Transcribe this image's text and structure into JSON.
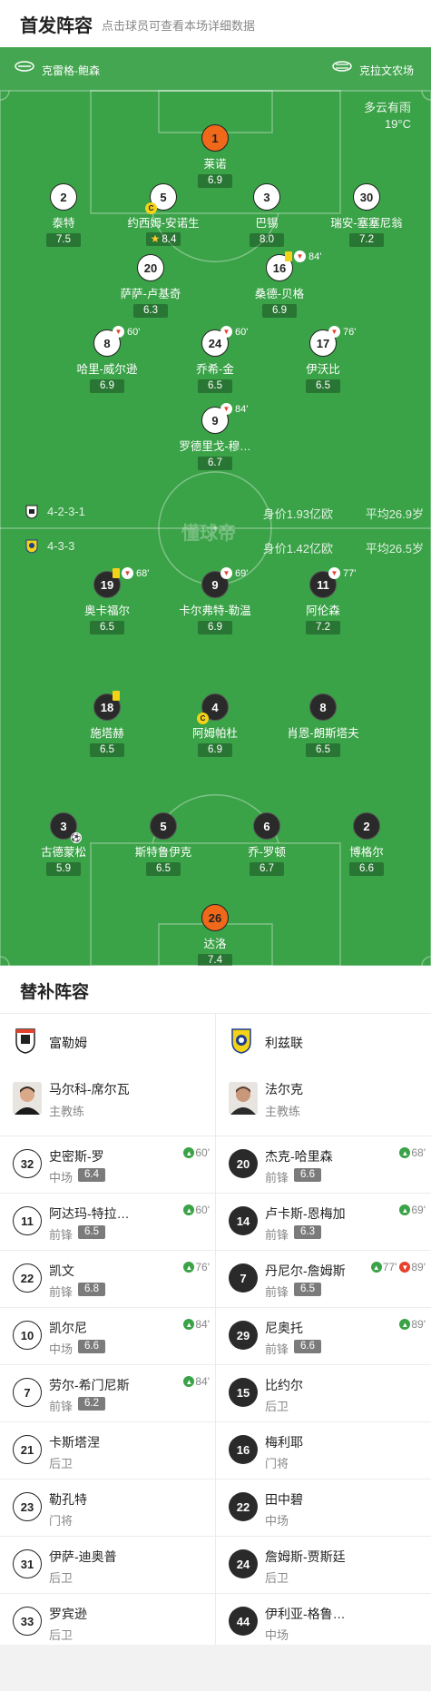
{
  "header": {
    "title": "首发阵容",
    "hint": "点击球员可查看本场详细数据"
  },
  "teams": {
    "home_label": "克雷格-鲍森",
    "away_label": "克拉文农场"
  },
  "weather": {
    "condition": "多云有雨",
    "temp": "19°C"
  },
  "watermark": "懂球帝",
  "home_summary": {
    "formation": "4-2-3-1",
    "value": "身价1.93亿欧",
    "age": "平均26.9岁"
  },
  "away_summary": {
    "formation": "4-3-3",
    "value": "身价1.42亿欧",
    "age": "平均26.5岁"
  },
  "home_players": [
    {
      "num": "1",
      "name": "莱诺",
      "rating": "6.9",
      "style": "gk"
    },
    {
      "num": "2",
      "name": "泰特",
      "rating": "7.5",
      "style": "white"
    },
    {
      "num": "5",
      "name": "约西姆-安诺生",
      "rating": "8.4",
      "style": "white",
      "captain": "C",
      "star": "★"
    },
    {
      "num": "3",
      "name": "巴锡",
      "rating": "8.0",
      "style": "white"
    },
    {
      "num": "30",
      "name": "瑞安-塞塞尼翁",
      "rating": "7.2",
      "style": "white"
    },
    {
      "num": "20",
      "name": "萨萨-卢基奇",
      "rating": "6.3",
      "style": "white"
    },
    {
      "num": "16",
      "name": "桑德-贝格",
      "rating": "6.9",
      "style": "white",
      "sub": "84'",
      "card": true
    },
    {
      "num": "8",
      "name": "哈里-威尔逊",
      "rating": "6.9",
      "style": "white",
      "sub": "60'"
    },
    {
      "num": "24",
      "name": "乔希-金",
      "rating": "6.5",
      "style": "white",
      "sub": "60'"
    },
    {
      "num": "17",
      "name": "伊沃比",
      "rating": "6.5",
      "style": "white",
      "sub": "76'"
    },
    {
      "num": "9",
      "name": "罗德里戈-穆…",
      "rating": "6.7",
      "style": "white",
      "sub": "84'"
    }
  ],
  "away_players": [
    {
      "num": "19",
      "name": "奥卡福尔",
      "rating": "6.5",
      "style": "dark",
      "sub": "68'",
      "card": true
    },
    {
      "num": "9",
      "name": "卡尔弗特-勒温",
      "rating": "6.9",
      "style": "dark",
      "sub": "69'"
    },
    {
      "num": "11",
      "name": "阿伦森",
      "rating": "7.2",
      "style": "dark",
      "sub": "77'"
    },
    {
      "num": "18",
      "name": "施塔赫",
      "rating": "6.5",
      "style": "dark",
      "cardSolo": true
    },
    {
      "num": "4",
      "name": "阿姆帕杜",
      "rating": "6.9",
      "style": "dark",
      "captain": "C"
    },
    {
      "num": "8",
      "name": "肖恩-朗斯塔夫",
      "rating": "6.5",
      "style": "dark"
    },
    {
      "num": "3",
      "name": "古德蒙松",
      "rating": "5.9",
      "style": "dark",
      "ball": "⚽"
    },
    {
      "num": "5",
      "name": "斯特鲁伊克",
      "rating": "6.5",
      "style": "dark"
    },
    {
      "num": "6",
      "name": "乔-罗顿",
      "rating": "6.7",
      "style": "dark"
    },
    {
      "num": "2",
      "name": "博格尔",
      "rating": "6.6",
      "style": "dark"
    },
    {
      "num": "26",
      "name": "达洛",
      "rating": "7.4",
      "style": "gk"
    }
  ],
  "subs_title": "替补阵容",
  "left": {
    "team": "富勒姆",
    "coach": {
      "name": "马尔科-席尔瓦",
      "role": "主教练"
    },
    "subs": [
      {
        "num": "32",
        "name": "史密斯-罗",
        "pos": "中场",
        "rating": "6.4",
        "in": "60'"
      },
      {
        "num": "11",
        "name": "阿达玛-特拉…",
        "pos": "前锋",
        "rating": "6.5",
        "in": "60'"
      },
      {
        "num": "22",
        "name": "凯文",
        "pos": "前锋",
        "rating": "6.8",
        "in": "76'"
      },
      {
        "num": "10",
        "name": "凯尔尼",
        "pos": "中场",
        "rating": "6.6",
        "in": "84'"
      },
      {
        "num": "7",
        "name": "劳尔-希门尼斯",
        "pos": "前锋",
        "rating": "6.2",
        "in": "84'"
      },
      {
        "num": "21",
        "name": "卡斯塔涅",
        "pos": "后卫"
      },
      {
        "num": "23",
        "name": "勒孔特",
        "pos": "门将"
      },
      {
        "num": "31",
        "name": "伊萨-迪奥普",
        "pos": "后卫"
      },
      {
        "num": "33",
        "name": "罗宾逊",
        "pos": "后卫"
      }
    ]
  },
  "right": {
    "team": "利兹联",
    "coach": {
      "name": "法尔克",
      "role": "主教练"
    },
    "subs": [
      {
        "num": "20",
        "name": "杰克-哈里森",
        "pos": "前锋",
        "rating": "6.6",
        "in": "68'"
      },
      {
        "num": "14",
        "name": "卢卡斯-恩梅加",
        "pos": "前锋",
        "rating": "6.3",
        "in": "69'"
      },
      {
        "num": "7",
        "name": "丹尼尔-詹姆斯",
        "pos": "前锋",
        "rating": "6.5",
        "in": "77'",
        "out": "89'"
      },
      {
        "num": "29",
        "name": "尼奥托",
        "pos": "前锋",
        "rating": "6.6",
        "in": "89'"
      },
      {
        "num": "15",
        "name": "比约尔",
        "pos": "后卫"
      },
      {
        "num": "16",
        "name": "梅利耶",
        "pos": "门将"
      },
      {
        "num": "22",
        "name": "田中碧",
        "pos": "中场"
      },
      {
        "num": "24",
        "name": "詹姆斯-贾斯廷",
        "pos": "后卫"
      },
      {
        "num": "44",
        "name": "伊利亚-格鲁…",
        "pos": "中场"
      }
    ]
  },
  "icons": {
    "up": "▲",
    "down": "▼",
    "sub_off": "▼"
  },
  "colors": {
    "pitch": "#3aa247",
    "gk": "#f0681a",
    "card": "#f4d218",
    "sub_in": "#3aa247",
    "sub_out": "#e5412d"
  }
}
